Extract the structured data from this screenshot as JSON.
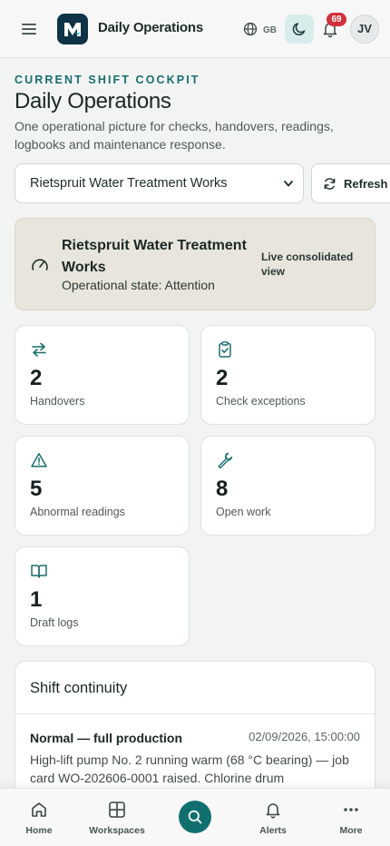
{
  "topbar": {
    "app_title": "Daily Operations",
    "language_code": "GB",
    "notifications_count": "69",
    "user_initials": "JV"
  },
  "page": {
    "eyebrow": "CURRENT SHIFT COCKPIT",
    "title": "Daily Operations",
    "subtitle": "One operational picture for checks, handovers, readings, logbooks and maintenance response."
  },
  "site_selector": {
    "selected": "Rietspruit Water Treatment Works"
  },
  "refresh_label": "Refresh",
  "status": {
    "site_name": "Rietspruit Water Treatment Works",
    "state": "Operational state: Attention",
    "view": "Live consolidated view"
  },
  "metrics": [
    {
      "value": "2",
      "label": "Handovers",
      "icon": "arrows-swap-icon"
    },
    {
      "value": "2",
      "label": "Check exceptions",
      "icon": "clipboard-check-icon"
    },
    {
      "value": "5",
      "label": "Abnormal readings",
      "icon": "warning-triangle-icon"
    },
    {
      "value": "8",
      "label": "Open work",
      "icon": "wrench-icon"
    },
    {
      "value": "1",
      "label": "Draft logs",
      "icon": "book-open-icon"
    }
  ],
  "continuity": {
    "title": "Shift continuity",
    "entry": {
      "title": "Normal — full production",
      "time": "02/09/2026, 15:00:00",
      "body": "High-lift pump No. 2 running warm (68 °C bearing) — job card WO-202606-0001 raised. Chlorine drum"
    }
  },
  "bottom_nav": {
    "home": "Home",
    "workspaces": "Workspaces",
    "alerts": "Alerts",
    "more": "More"
  },
  "colors": {
    "accent": "#11706f",
    "status_card_bg": "#e8e6dc",
    "badge": "#d12f3a",
    "logo_bg": "#0f3346"
  }
}
